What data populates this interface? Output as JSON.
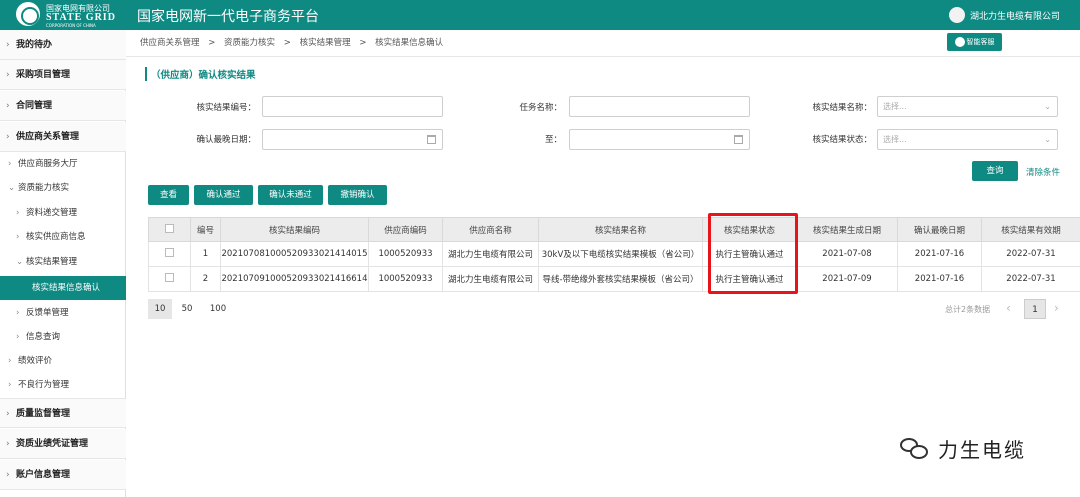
{
  "header": {
    "logo_cn": "国家电网有限公司",
    "logo_en": "STATE GRID",
    "logo_sub": "CORPORATION OF CHINA",
    "app_title": "国家电网新一代电子商务平台",
    "user_name": "湖北力生电缆有限公司"
  },
  "sidebar": {
    "items": [
      {
        "label": "我的待办"
      },
      {
        "label": "采购项目管理"
      },
      {
        "label": "合同管理"
      },
      {
        "label": "供应商关系管理"
      }
    ],
    "sub_items": [
      {
        "label": "供应商服务大厅"
      },
      {
        "label": "资质能力核实"
      },
      {
        "label": "资料递交管理"
      },
      {
        "label": "核实供应商信息"
      },
      {
        "label": "核实结果管理"
      },
      {
        "label": "核实结果信息确认"
      },
      {
        "label": "反馈单管理"
      },
      {
        "label": "信息查询"
      },
      {
        "label": "绩效评价"
      },
      {
        "label": "不良行为管理"
      }
    ],
    "bottom_items": [
      {
        "label": "质量监督管理"
      },
      {
        "label": "资质业绩凭证管理"
      },
      {
        "label": "账户信息管理"
      }
    ]
  },
  "breadcrumb": {
    "items": [
      "供应商关系管理",
      ">",
      "资质能力核实",
      ">",
      "核实结果管理",
      ">",
      "核实结果信息确认"
    ]
  },
  "service_button": "智能客服",
  "section_title": "（供应商）确认核实结果",
  "filters": {
    "result_no_label": "核实结果编号：",
    "task_name_label": "任务名称：",
    "result_name_label": "核实结果名称：",
    "result_name_placeholder": "选择...",
    "confirm_date_label": "确认最晚日期：",
    "to_label": "至：",
    "result_status_label": "核实结果状态：",
    "result_status_placeholder": "选择..."
  },
  "query_button": "查询",
  "clear_link": "清除条件",
  "actions": {
    "view": "查看",
    "confirm_pass": "确认通过",
    "confirm_fail": "确认未通过",
    "revoke": "撤销确认"
  },
  "table": {
    "headers": [
      "",
      "编号",
      "核实结果编码",
      "供应商编码",
      "供应商名称",
      "核实结果名称",
      "核实结果状态",
      "核实结果生成日期",
      "确认最晚日期",
      "核实结果有效期"
    ],
    "rows": [
      [
        "",
        "1",
        "20210708100052093302141401​5",
        "1000520933",
        "湖北力生电缆有限公司",
        "30kV及以下电缆核实结果模板（省公司）",
        "执行主管确认通过",
        "2021-07-08",
        "2021-07-16",
        "2022-07-31"
      ],
      [
        "",
        "2",
        "202107091000520933021416614",
        "1000520933",
        "湖北力生电缆有限公司",
        "导线-带绝缘外套核实结果模板（省公司）",
        "执行主管确认通过",
        "2021-07-09",
        "2021-07-16",
        "2022-07-31"
      ]
    ]
  },
  "pager": {
    "sizes": [
      "10",
      "50",
      "100"
    ],
    "total": "总计2条数据",
    "current_page": "1"
  },
  "watermark": "力生电缆"
}
